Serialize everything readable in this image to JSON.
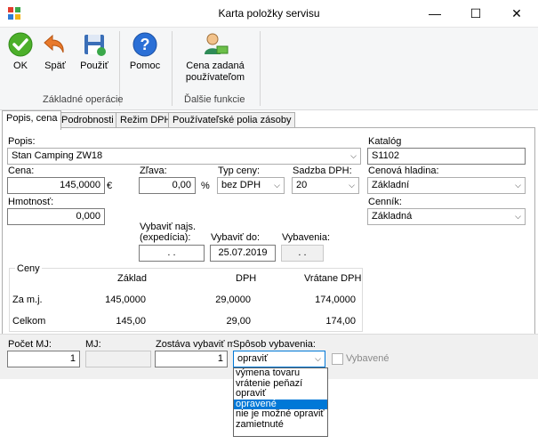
{
  "window": {
    "title": "Karta položky servisu",
    "minimize": "—",
    "maximize": "☐",
    "close": "✕"
  },
  "ribbon": {
    "buttons": {
      "ok": "OK",
      "back": "Späť",
      "apply": "Použiť",
      "help": "Pomoc",
      "user_price": "Cena zadaná používateľom"
    },
    "groups": {
      "basic": "Základné operácie",
      "other": "Ďalšie funkcie"
    }
  },
  "tabs": [
    "Popis, cena",
    "Podrobnosti",
    "Režim DPH",
    "Používateľské polia zásoby"
  ],
  "form": {
    "popis_label": "Popis:",
    "popis_value": "Stan Camping ZW18",
    "katalog_label": "Katalóg",
    "katalog_value": "S1102",
    "cena_label": "Cena:",
    "cena_value": "145,0000",
    "currency": "€",
    "zlava_label": "Zľava:",
    "zlava_value": "0,00",
    "percent": "%",
    "typ_ceny_label": "Typ ceny:",
    "typ_ceny_value": "bez DPH",
    "sadzba_label": "Sadzba DPH:",
    "sadzba_value": "20",
    "cenova_hladina_label": "Cenová hladina:",
    "cenova_hladina_value": "Základní",
    "hmotnost_label": "Hmotnosť:",
    "hmotnost_value": "0,000",
    "cennik_label": "Cenník:",
    "cennik_value": "Základná",
    "vybavit_najs_label": "Vybaviť najs. (expedícia):",
    "vybavit_najs_value": ". .",
    "vybavit_do_label": "Vybaviť do:",
    "vybavit_do_value": "25.07.2019",
    "vybavenia_label": "Vybavenia:",
    "vybavenia_value": ". ."
  },
  "ceny": {
    "group_label": "Ceny",
    "headers": [
      "Základ",
      "DPH",
      "Vrátane DPH"
    ],
    "rows": [
      {
        "label": "Za m.j.",
        "zaklad": "145,0000",
        "dph": "29,0000",
        "vratane": "174,0000"
      },
      {
        "label": "Celkom",
        "zaklad": "145,00",
        "dph": "29,00",
        "vratane": "174,00"
      }
    ]
  },
  "bottom": {
    "pocet_label": "Počet MJ:",
    "pocet_value": "1",
    "mj_label": "MJ:",
    "mj_value": "",
    "zostava_label": "Zostáva vybaviť m.j.:",
    "zostava_value": "1",
    "sposob_label": "Spôsob vybavenia:",
    "sposob_value": "opraviť",
    "vybavene_label": "Vybavené"
  },
  "dropdown": {
    "options": [
      "výmena tovaru",
      "vrátenie peňazí",
      "opraviť",
      "opravené",
      "nie je možné opraviť",
      "zamietnuté"
    ],
    "selected_index": 3
  },
  "colors": {
    "accent": "#0078d7",
    "ok_green": "#4caf2a",
    "help_blue": "#2a6fd6"
  }
}
